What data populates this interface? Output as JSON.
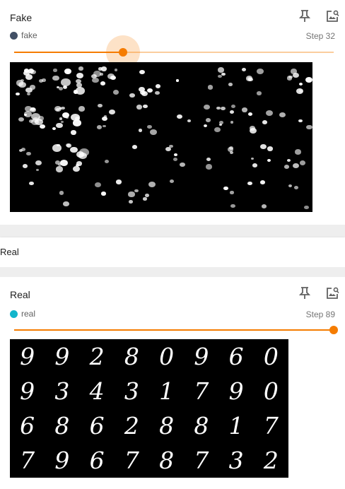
{
  "fake_card": {
    "title": "Fake",
    "run": {
      "name": "fake",
      "color": "#425066"
    },
    "step_label": "Step 32",
    "slider_fraction": 0.34,
    "accent": "#f57c00"
  },
  "group": {
    "label": "Real"
  },
  "real_card": {
    "title": "Real",
    "run": {
      "name": "real",
      "color": "#12b5cb"
    },
    "step_label": "Step 89",
    "slider_fraction": 1.0,
    "accent": "#f57c00",
    "digits": [
      [
        "9",
        "9",
        "2",
        "8",
        "0",
        "9",
        "6",
        "0"
      ],
      [
        "9",
        "3",
        "4",
        "3",
        "1",
        "7",
        "9",
        "0"
      ],
      [
        "6",
        "8",
        "6",
        "2",
        "8",
        "8",
        "1",
        "7"
      ],
      [
        "7",
        "9",
        "6",
        "7",
        "8",
        "7",
        "3",
        "2"
      ]
    ]
  },
  "icons": {
    "pin": "pin-icon",
    "image_settings": "image-settings-icon"
  }
}
